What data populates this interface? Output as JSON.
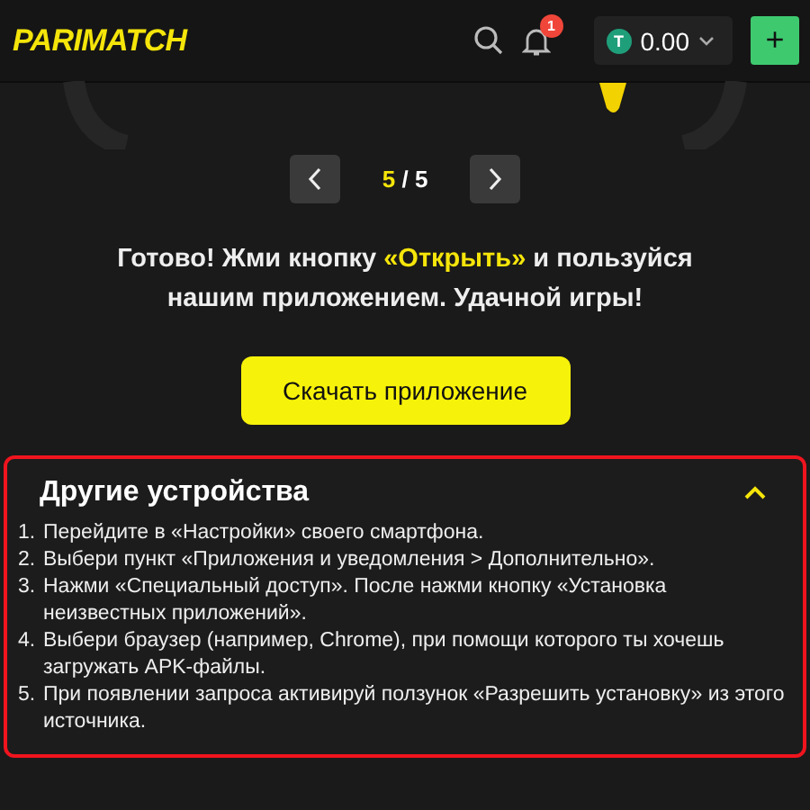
{
  "header": {
    "logo": "PARIMATCH",
    "notifications": {
      "count": "1"
    },
    "balance": {
      "currency_symbol": "T",
      "amount": "0.00"
    },
    "add_button": "+"
  },
  "carousel": {
    "current": "5",
    "separator": "/",
    "total": "5"
  },
  "message": "Готово! Жми кнопку **«Открыть»** и пользуйся нашим приложением. Удачной игры!",
  "download_button": "Скачать приложение",
  "other_devices": {
    "title": "Другие устройства",
    "expanded": true,
    "highlighted": true,
    "steps": [
      {
        "number": "1.",
        "text": "Перейдите в «Настройки» своего смартфона."
      },
      {
        "number": "2.",
        "text": "Выбери пункт «Приложения и уведомления > Дополнительно»."
      },
      {
        "number": "3.",
        "text": "Нажми «Специальный доступ». После нажми кнопку «Установка неизвестных приложений»."
      },
      {
        "number": "4.",
        "text": "Выбери браузер (например, Chrome), при помощи которого ты хочешь загружать APK-файлы."
      },
      {
        "number": "5.",
        "text": "При появлении запроса активируй ползунок «Разрешить установку» из этого источника."
      }
    ]
  }
}
